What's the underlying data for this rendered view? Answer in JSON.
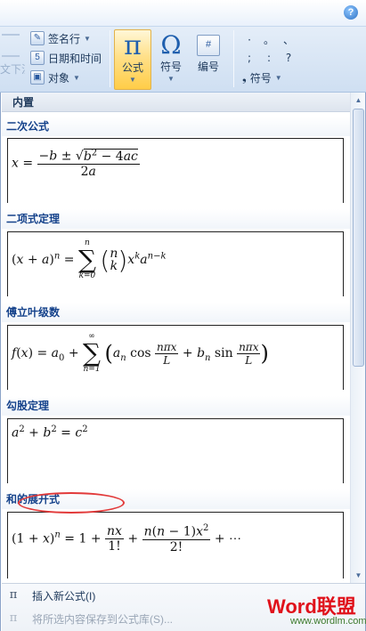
{
  "ribbon": {
    "cut_label": "文下沉",
    "signature_label": "签名行",
    "datetime_label": "日期和时间",
    "object_label": "对象",
    "equation_glyph": "π",
    "equation_label": "公式",
    "symbol_glyph": "Ω",
    "symbol_label": "符号",
    "number_glyph": "#",
    "number_label": "编号",
    "symbols_grid": [
      "·",
      "。",
      "、",
      ";",
      ":",
      "?"
    ],
    "symbols_small_glyph": "❟",
    "symbols_small_label": "符号"
  },
  "gallery": {
    "header": "内置",
    "items": [
      {
        "title": "二次公式"
      },
      {
        "title": "二项式定理"
      },
      {
        "title": "傅立叶级数"
      },
      {
        "title": "勾股定理"
      },
      {
        "title": "和的展开式"
      }
    ]
  },
  "footer": {
    "insert_label": "插入新公式(I)",
    "save_label": "将所选内容保存到公式库(S)..."
  },
  "watermark": {
    "brand": "Word联盟",
    "url": "www.wordlm.com"
  },
  "colors": {
    "accent_highlight": "#ffcd48",
    "category_text": "#15428b",
    "annotation_ring": "#e23a3a",
    "watermark_red": "#e0111a"
  }
}
